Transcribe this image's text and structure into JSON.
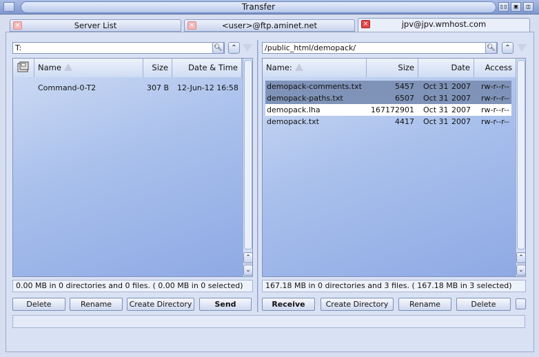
{
  "window": {
    "title": "Transfer"
  },
  "tabs": [
    {
      "label": "Server List"
    },
    {
      "label": "<user>@ftp.aminet.net"
    },
    {
      "label": "jpv@jpv.wmhost.com"
    }
  ],
  "left": {
    "path": "T:",
    "columns": {
      "name": "Name",
      "size": "Size",
      "date": "Date & Time"
    },
    "files": [
      {
        "name": "Command-0-T2",
        "size": "307 B",
        "date": "12-Jun-12 16:58"
      }
    ],
    "status": "0.00 MB in 0 directories and 0 files. ( 0.00 MB in 0 selected)",
    "buttons": {
      "delete": "Delete",
      "rename": "Rename",
      "create_dir": "Create Directory",
      "send": "Send"
    }
  },
  "right": {
    "path": "/public_html/demopack/",
    "columns": {
      "name": "Name:",
      "size": "Size",
      "date": "Date",
      "access": "Access"
    },
    "files": [
      {
        "name": "demopack-comments.txt",
        "size": "5457",
        "month": "Oct 31",
        "year": "2007",
        "access": "rw-r--r--",
        "state": "selected"
      },
      {
        "name": "demopack-paths.txt",
        "size": "6507",
        "month": "Oct 31",
        "year": "2007",
        "access": "rw-r--r--",
        "state": "selected"
      },
      {
        "name": "demopack.lha",
        "size": "167172901",
        "month": "Oct 31",
        "year": "2007",
        "access": "rw-r--r--",
        "state": "focused"
      },
      {
        "name": "demopack.txt",
        "size": "4417",
        "month": "Oct 31",
        "year": "2007",
        "access": "rw-r--r--",
        "state": "normal"
      }
    ],
    "status": "167.18 MB in 0 directories and 3 files. ( 167.18 MB in 3 selected)",
    "buttons": {
      "receive": "Receive",
      "create_dir": "Create Directory",
      "rename": "Rename",
      "delete": "Delete"
    }
  },
  "icons": {
    "search": "magnifier-icon",
    "parent": "up-arrow-icon",
    "history": "down-triangle-icon",
    "disk": "disk-icon",
    "sort": "sort-ascending-icon"
  }
}
